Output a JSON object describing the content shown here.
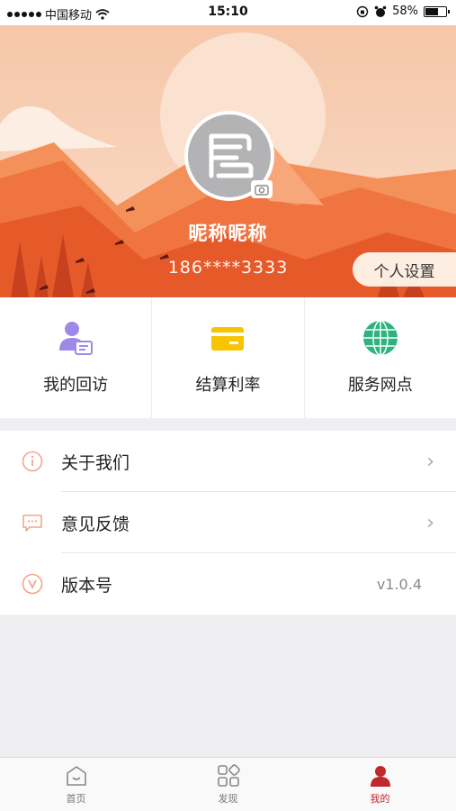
{
  "status_bar": {
    "carrier": "中国移动",
    "time": "15:10",
    "battery": "58%",
    "battery_level": 0.58
  },
  "profile": {
    "nickname": "昵称昵称",
    "phone": "186****3333",
    "settings_label": "个人设置",
    "avatar_icon": "logo-icon",
    "camera_icon": "camera-icon"
  },
  "quick_actions": [
    {
      "label": "我的回访",
      "icon": "user-card-icon"
    },
    {
      "label": "结算利率",
      "icon": "card-icon"
    },
    {
      "label": "服务网点",
      "icon": "globe-icon"
    }
  ],
  "menu": [
    {
      "label": "关于我们",
      "icon": "info-icon",
      "chevron": "›"
    },
    {
      "label": "意见反馈",
      "icon": "chat-icon",
      "chevron": "›"
    },
    {
      "label": "版本号",
      "icon": "version-icon",
      "value": "v1.0.4"
    }
  ],
  "tabbar": [
    {
      "label": "首页",
      "icon": "home-icon"
    },
    {
      "label": "发现",
      "icon": "discover-icon"
    },
    {
      "label": "我的",
      "icon": "me-icon",
      "active": true
    }
  ],
  "colors": {
    "accent": "#c0282a",
    "header_orange": "#f0763a",
    "info_icon": "#f3a58c"
  }
}
